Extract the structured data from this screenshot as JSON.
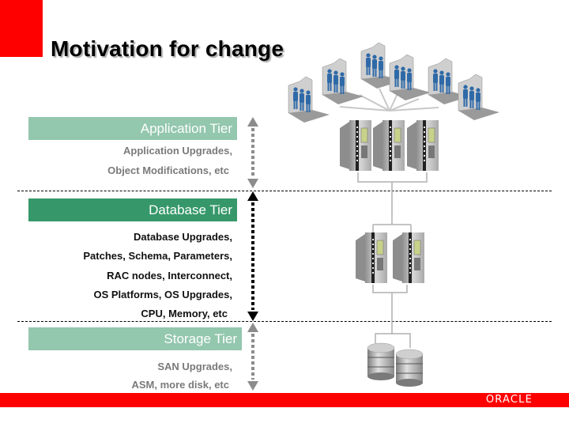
{
  "slide": {
    "title": "Motivation for change",
    "brand": "ORACLE",
    "colors": {
      "accent_red": "#ff0000",
      "tier_light_green": "#93c7ae",
      "tier_dark_green": "#36986a",
      "people_blue": "#2f6aa8"
    }
  },
  "tiers": [
    {
      "label": "Application Tier",
      "highlighted": false,
      "details": [
        "Application Upgrades,",
        "Object Modifications, etc"
      ],
      "icon": "user-groups-icon"
    },
    {
      "label": "Database Tier",
      "highlighted": true,
      "details": [
        "Database Upgrades,",
        "Patches, Schema, Parameters,",
        "RAC nodes, Interconnect,",
        "OS Platforms, OS Upgrades,",
        "CPU, Memory, etc"
      ],
      "icon": "server-icon"
    },
    {
      "label": "Storage Tier",
      "highlighted": false,
      "details": [
        "SAN Upgrades,",
        "ASM, more disk, etc"
      ],
      "icon": "disk-storage-icon"
    }
  ],
  "diagram": {
    "user_groups": 6,
    "app_servers": 3,
    "db_servers": 2,
    "storage_disks": 2
  }
}
